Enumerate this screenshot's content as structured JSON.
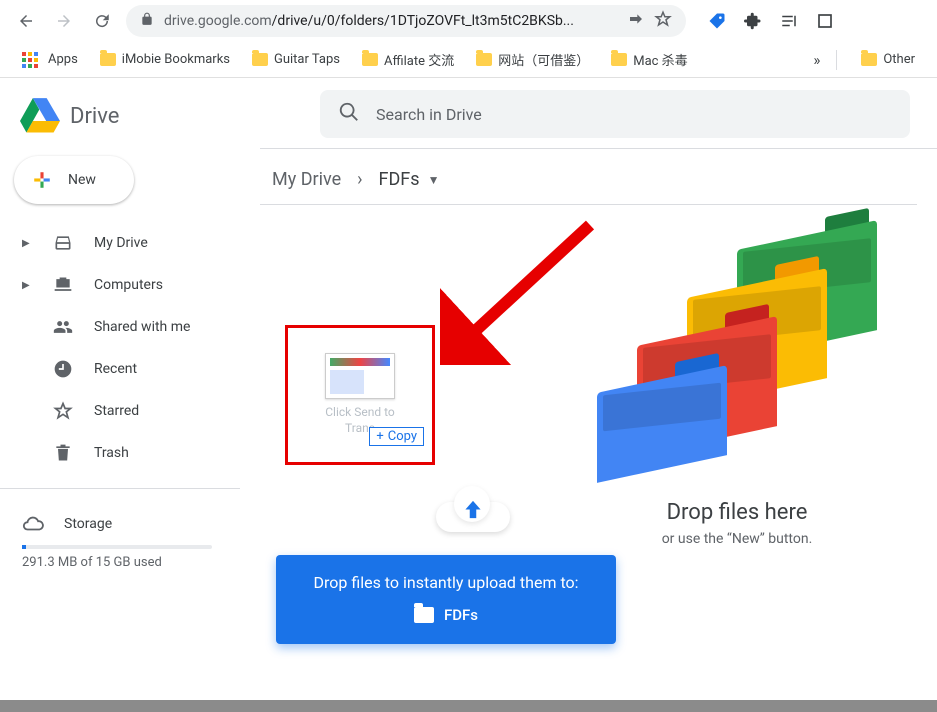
{
  "browser": {
    "url_host": "drive.google.com",
    "url_path": "/drive/u/0/folders/1DTjoZOVFt_lt3m5tC2BKSb..."
  },
  "bookmarks": {
    "apps_label": "Apps",
    "items": [
      "iMobie Bookmarks",
      "Guitar Taps",
      "Affilate 交流",
      "网站（可借鉴）",
      "Mac 杀毒"
    ],
    "overflow": "»",
    "other": "Other"
  },
  "app": {
    "product": "Drive",
    "new_button": "New",
    "nav": {
      "my_drive": "My Drive",
      "computers": "Computers",
      "shared": "Shared with me",
      "recent": "Recent",
      "starred": "Starred",
      "trash": "Trash",
      "storage": "Storage"
    },
    "storage_used": "291.3 MB of 15 GB used"
  },
  "search": {
    "placeholder": "Search in Drive"
  },
  "breadcrumb": {
    "root": "My Drive",
    "current": "FDFs"
  },
  "drag_file": {
    "name_line1": "Click Send to",
    "name_line2": "Trans",
    "copy_label": "Copy"
  },
  "dropzone": {
    "title": "Drop files here",
    "subtitle": "or use the “New” button."
  },
  "banner": {
    "text": "Drop files to instantly upload them to:",
    "folder": "FDFs"
  }
}
